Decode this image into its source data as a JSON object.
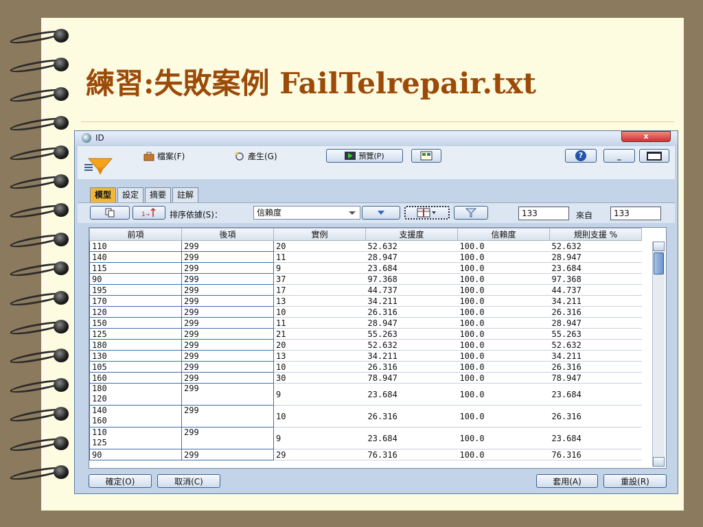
{
  "slide": {
    "title": "練習:失敗案例 FailTelrepair.txt"
  },
  "window": {
    "title": "ID",
    "close_label": "x",
    "menu": {
      "file": "檔案(F)",
      "generate": "產生(G)"
    },
    "toolbar": {
      "preview": "預覽(P)",
      "help": "?",
      "minimize": "_"
    },
    "tabs": [
      "模型",
      "設定",
      "摘要",
      "註解"
    ],
    "sort": {
      "label": "排序依據(S)：",
      "value": "信賴度"
    },
    "count": {
      "shown": "133",
      "from_label": "來自",
      "total": "133"
    },
    "table": {
      "columns": [
        "前項",
        "後項",
        "實例",
        "支援度",
        "信賴度",
        "規則支援 %"
      ],
      "rows": [
        {
          "antecedent": [
            "110"
          ],
          "consequent": "299",
          "instances": "20",
          "support": "52.632",
          "confidence": "100.0",
          "rule_support": "52.632"
        },
        {
          "antecedent": [
            "140"
          ],
          "consequent": "299",
          "instances": "11",
          "support": "28.947",
          "confidence": "100.0",
          "rule_support": "28.947"
        },
        {
          "antecedent": [
            "115"
          ],
          "consequent": "299",
          "instances": "9",
          "support": "23.684",
          "confidence": "100.0",
          "rule_support": "23.684"
        },
        {
          "antecedent": [
            "90"
          ],
          "consequent": "299",
          "instances": "37",
          "support": "97.368",
          "confidence": "100.0",
          "rule_support": "97.368"
        },
        {
          "antecedent": [
            "195"
          ],
          "consequent": "299",
          "instances": "17",
          "support": "44.737",
          "confidence": "100.0",
          "rule_support": "44.737"
        },
        {
          "antecedent": [
            "170"
          ],
          "consequent": "299",
          "instances": "13",
          "support": "34.211",
          "confidence": "100.0",
          "rule_support": "34.211"
        },
        {
          "antecedent": [
            "120"
          ],
          "consequent": "299",
          "instances": "10",
          "support": "26.316",
          "confidence": "100.0",
          "rule_support": "26.316"
        },
        {
          "antecedent": [
            "150"
          ],
          "consequent": "299",
          "instances": "11",
          "support": "28.947",
          "confidence": "100.0",
          "rule_support": "28.947"
        },
        {
          "antecedent": [
            "125"
          ],
          "consequent": "299",
          "instances": "21",
          "support": "55.263",
          "confidence": "100.0",
          "rule_support": "55.263"
        },
        {
          "antecedent": [
            "180"
          ],
          "consequent": "299",
          "instances": "20",
          "support": "52.632",
          "confidence": "100.0",
          "rule_support": "52.632"
        },
        {
          "antecedent": [
            "130"
          ],
          "consequent": "299",
          "instances": "13",
          "support": "34.211",
          "confidence": "100.0",
          "rule_support": "34.211"
        },
        {
          "antecedent": [
            "105"
          ],
          "consequent": "299",
          "instances": "10",
          "support": "26.316",
          "confidence": "100.0",
          "rule_support": "26.316"
        },
        {
          "antecedent": [
            "160"
          ],
          "consequent": "299",
          "instances": "30",
          "support": "78.947",
          "confidence": "100.0",
          "rule_support": "78.947"
        },
        {
          "antecedent": [
            "180",
            "120"
          ],
          "consequent": "299",
          "instances": "9",
          "support": "23.684",
          "confidence": "100.0",
          "rule_support": "23.684"
        },
        {
          "antecedent": [
            "140",
            "160"
          ],
          "consequent": "299",
          "instances": "10",
          "support": "26.316",
          "confidence": "100.0",
          "rule_support": "26.316"
        },
        {
          "antecedent": [
            "110",
            "125"
          ],
          "consequent": "299",
          "instances": "9",
          "support": "23.684",
          "confidence": "100.0",
          "rule_support": "23.684"
        },
        {
          "antecedent": [
            "90"
          ],
          "consequent": "299",
          "instances": "29",
          "support": "76.316",
          "confidence": "100.0",
          "rule_support": "76.316"
        }
      ]
    },
    "buttons": {
      "ok": "確定(O)",
      "cancel": "取消(C)",
      "apply": "套用(A)",
      "reset": "重設(R)"
    }
  }
}
